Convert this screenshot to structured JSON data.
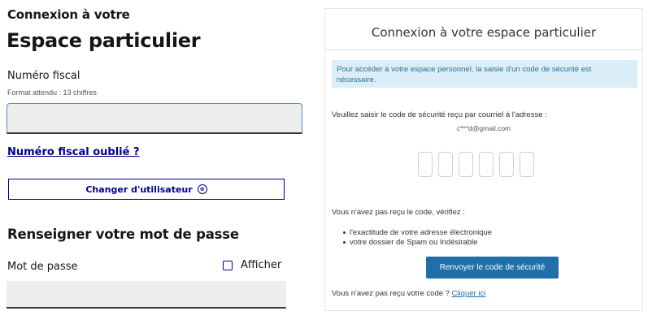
{
  "left": {
    "heading_small": "Connexion à votre",
    "heading_big": "Espace particulier",
    "fiscal_label": "Numéro fiscal",
    "fiscal_hint": "Format attendu : 13 chiffres",
    "fiscal_value": "",
    "forgot_link": "Numéro fiscal oublié ?",
    "change_user_button": "Changer d'utilisateur",
    "change_user_icon": "⊗",
    "password_section_title": "Renseigner votre mot de passe",
    "password_label": "Mot de passe",
    "show_label": "Afficher",
    "password_value": ""
  },
  "right": {
    "title": "Connexion à votre espace particulier",
    "info_text": "Pour accéder à votre espace personnel, la saisie d'un code de sécurité est nécessaire.",
    "prompt": "Veuillez saisir le code de sécurité reçu par courriel à l'adresse :",
    "email": "c***d@gmail.com",
    "code_digits": [
      "",
      "",
      "",
      "",
      "",
      ""
    ],
    "not_received": "Vous n'avez pas reçu le code, vérifiez :",
    "checks": [
      "l'exactitude de votre adresse électronique",
      "votre dossier de Spam ou Indésirable"
    ],
    "resend_button": "Renvoyer le code de sécurité",
    "footer_text": "Vous n'avez pas reçu votre code ?",
    "footer_link": "Cliquer ici"
  },
  "colors": {
    "brand_blue": "#000091",
    "input_bg": "#eeeeee",
    "info_bg": "#dbeef7",
    "button_blue": "#1f6fa8"
  }
}
